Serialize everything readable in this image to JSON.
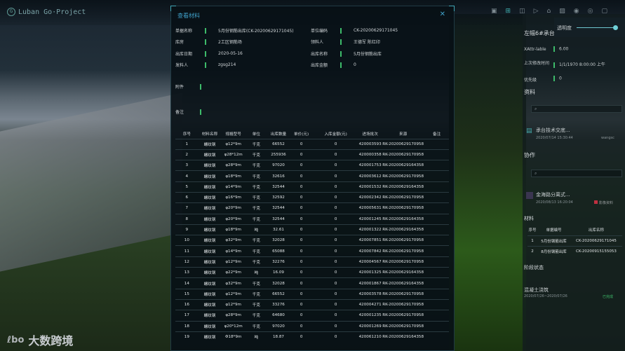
{
  "app": {
    "title": "Luban Go·Project",
    "brand": "大数跨境",
    "brand_mark": "ℓbo"
  },
  "toolbar": {
    "icons": [
      "select-icon",
      "measure-icon",
      "split-icon",
      "video-icon",
      "home-icon",
      "image-icon",
      "eye-icon",
      "eye-alt-icon",
      "more-icon"
    ]
  },
  "modal": {
    "title": "查看材料",
    "close": "✕",
    "fields": [
      {
        "label": "单据名称",
        "value": "5月份钢筋出库(CK-20200629171045)"
      },
      {
        "label": "单位编码",
        "value": "CK-20200629171045"
      },
      {
        "label": "库房",
        "value": "2工区钢筋场"
      },
      {
        "label": "领料人",
        "value": "王德军 陈红印"
      },
      {
        "label": "出库日期",
        "value": "2020-05-16"
      },
      {
        "label": "出库名称",
        "value": "5月份钢筋出库"
      },
      {
        "label": "发料人",
        "value": "zgsg214"
      },
      {
        "label": "出库金额",
        "value": "0"
      }
    ],
    "attachment_label": "附件",
    "remark_label": "备注",
    "columns": [
      "序号",
      "材料名称",
      "规格型号",
      "单位",
      "出库数量",
      "单价(元)",
      "入库金额(元)",
      "进场批次",
      "来源",
      "备注"
    ],
    "rows": [
      [
        "1",
        "螺纹钢",
        "φ12*9m",
        "千克",
        "66552",
        "0",
        "0",
        "420003593",
        "RK-20200629170958",
        ""
      ],
      [
        "2",
        "螺纹钢",
        "φ28*12m",
        "千克",
        "255936",
        "0",
        "0",
        "420000358",
        "RK-20200629170958",
        ""
      ],
      [
        "3",
        "螺纹钢",
        "φ28*9m",
        "千克",
        "97020",
        "0",
        "0",
        "420001753",
        "RK-20200629164358",
        ""
      ],
      [
        "4",
        "螺纹钢",
        "φ18*9m",
        "千克",
        "32616",
        "0",
        "0",
        "420003612",
        "RK-20200629170958",
        ""
      ],
      [
        "5",
        "螺纹钢",
        "φ14*9m",
        "千克",
        "32544",
        "0",
        "0",
        "420001532",
        "RK-20200629164358",
        ""
      ],
      [
        "6",
        "螺纹钢",
        "φ16*9m",
        "千克",
        "32592",
        "0",
        "0",
        "420002342",
        "RK-20200629170958",
        ""
      ],
      [
        "7",
        "螺纹钢",
        "φ20*9m",
        "千克",
        "32544",
        "0",
        "0",
        "420005631",
        "RK-20200629170958",
        ""
      ],
      [
        "8",
        "螺纹钢",
        "φ20*9m",
        "千克",
        "32544",
        "0",
        "0",
        "420001245",
        "RK-20200629164358",
        ""
      ],
      [
        "9",
        "螺纹钢",
        "φ18*9m",
        "吨",
        "32.61",
        "0",
        "0",
        "420001322",
        "RK-20200629164358",
        ""
      ],
      [
        "10",
        "螺纹钢",
        "φ32*9m",
        "千克",
        "32028",
        "0",
        "0",
        "420007851",
        "RK-20200629170958",
        ""
      ],
      [
        "11",
        "螺纹钢",
        "φ14*9m",
        "千克",
        "65088",
        "0",
        "0",
        "420007842",
        "RK-20200629170958",
        ""
      ],
      [
        "12",
        "螺纹钢",
        "φ12*9m",
        "千克",
        "32276",
        "0",
        "0",
        "420004567",
        "RK-20200629170958",
        ""
      ],
      [
        "13",
        "螺纹钢",
        "φ22*9m",
        "吨",
        "16.09",
        "0",
        "0",
        "420001325",
        "RK-20200629164358",
        ""
      ],
      [
        "14",
        "螺纹钢",
        "φ32*9m",
        "千克",
        "32028",
        "0",
        "0",
        "420001867",
        "RK-20200629164358",
        ""
      ],
      [
        "15",
        "螺纹钢",
        "φ12*9m",
        "千克",
        "66552",
        "0",
        "0",
        "420003578",
        "RK-20200629170958",
        ""
      ],
      [
        "16",
        "螺纹钢",
        "φ12*9m",
        "千克",
        "33276",
        "0",
        "0",
        "420004271",
        "RK-20200629170958",
        ""
      ],
      [
        "17",
        "螺纹钢",
        "φ28*9m",
        "千克",
        "64680",
        "0",
        "0",
        "420001235",
        "RK-20200629170958",
        ""
      ],
      [
        "18",
        "螺纹钢",
        "φ20*12m",
        "千克",
        "97020",
        "0",
        "0",
        "420001269",
        "RK-20200629170958",
        ""
      ],
      [
        "19",
        "螺纹钢",
        "Φ18*9m",
        "吨",
        "18.87",
        "0",
        "0",
        "420061210",
        "RK-20200629164358",
        ""
      ]
    ]
  },
  "right_panel": {
    "opacity_label": "透明度",
    "opacity_value": 1.0,
    "title": "左幅6#承台",
    "props": [
      {
        "label": "XAttr-lable",
        "value": "6.00"
      },
      {
        "label": "上次修改时间",
        "value": "1/1/1970 8:00:00 上午"
      },
      {
        "label": "优先级",
        "value": "0"
      }
    ],
    "docs_title": "资料",
    "doc": {
      "name": "承台技术交底...",
      "time": "2020/07/14 15:30:44",
      "user": "wangsc"
    },
    "collab_title": "协作",
    "collab": {
      "name": "金海路分离式...",
      "time": "2020/08/13 16:20:04",
      "tag": "影像资料"
    },
    "materials_title": "材料",
    "materials_columns": [
      "序号",
      "单据编号",
      "出库名称"
    ],
    "materials_rows": [
      [
        "1",
        "5月份钢筋出库",
        "CK-20200629171045"
      ],
      [
        "2",
        "8月份钢筋出库",
        "CK-20200915155053"
      ]
    ],
    "stage_title": "阶段状态",
    "stage": {
      "name": "混凝土浇筑",
      "range": "2020/07/26~2020/07/26",
      "status": "已完成"
    }
  }
}
